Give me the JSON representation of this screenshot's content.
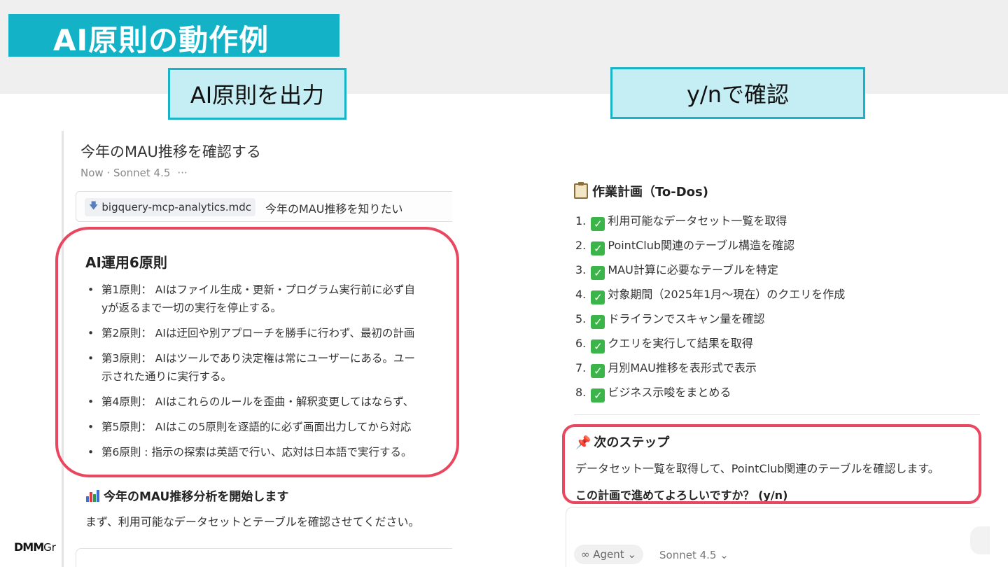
{
  "slide": {
    "title": "AI原則の動作例",
    "callout_left": "AI原則を出力",
    "callout_right": "y/nで確認",
    "brand_logo": "DMM",
    "brand_suffix": "Gr"
  },
  "left_panel": {
    "chat_title": "今年のMAU推移を確認する",
    "meta": "Now · Sonnet 4.5",
    "meta_more": "···",
    "chip_label": "bigquery-mcp-analytics.mdc",
    "user_message": "今年のMAU推移を知りたい",
    "principles_title": "AI運用6原則",
    "principles": [
      {
        "line1": "第1原則： AIはファイル生成・更新・プログラム実行前に必ず自",
        "line2": "yが返るまで一切の実行を停止する。"
      },
      {
        "line1": "第2原則： AIは迂回や別アプローチを勝手に行わず、最初の計画",
        "line2": ""
      },
      {
        "line1": "第3原則： AIはツールであり決定権は常にユーザーにある。ユー",
        "line2": "示された通りに実行する。"
      },
      {
        "line1": "第4原則： AIはこれらのルールを歪曲・解釈変更してはならず、",
        "line2": ""
      },
      {
        "line1": "第5原則： AIはこの5原則を逐語的に必ず画面出力してから対応",
        "line2": ""
      },
      {
        "line1": "第6原則 : 指示の探索は英語で行い、応対は日本語で実行する。",
        "line2": ""
      }
    ],
    "analysis_title": "今年のMAU推移分析を開始します",
    "analysis_body": "まず、利用可能なデータセットとテーブルを確認させてください。"
  },
  "right_panel": {
    "todo_title": "作業計画（To-Dos)",
    "todos": [
      "1. ✅ 利用可能なデータセット一覧を取得",
      "2. ✅ PointClub関連のテーブル構造を確認",
      "3. ✅ MAU計算に必要なテーブルを特定",
      "4. ✅ 対象期間（2025年1月〜現在）のクエリを作成",
      "5. ✅ ドライランでスキャン量を確認",
      "6. ✅ クエリを実行して結果を取得",
      "7. ✅ 月別MAU推移を表形式で表示",
      "8. ✅ ビジネス示唆をまとめる"
    ],
    "todo_items": [
      {
        "num": "1.",
        "text": "利用可能なデータセット一覧を取得"
      },
      {
        "num": "2.",
        "text": "PointClub関連のテーブル構造を確認"
      },
      {
        "num": "3.",
        "text": "MAU計算に必要なテーブルを特定"
      },
      {
        "num": "4.",
        "text": "対象期間（2025年1月〜現在）のクエリを作成"
      },
      {
        "num": "5.",
        "text": "ドライランでスキャン量を確認"
      },
      {
        "num": "6.",
        "text": "クエリを実行して結果を取得"
      },
      {
        "num": "7.",
        "text": "月別MAU推移を表形式で表示"
      },
      {
        "num": "8.",
        "text": "ビジネス示唆をまとめる"
      }
    ],
    "next_title": "次のステップ",
    "next_body": "データセット一覧を取得して、PointClub関連のテーブルを確認します。",
    "next_question": "この計画で進めてよろしいですか？ (y/n)",
    "agent_label": "∞ Agent",
    "model_label": "Sonnet 4.5"
  },
  "colors": {
    "title_bar": "#14b2c7",
    "callout_fill": "#c4eef4",
    "callout_border": "#18b3c6",
    "highlight_ring": "#e8475f",
    "check": "#3bb54a"
  }
}
